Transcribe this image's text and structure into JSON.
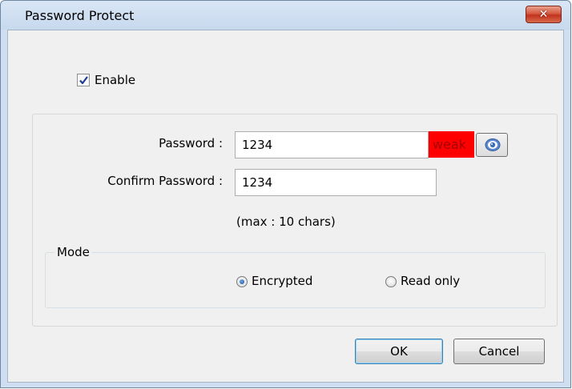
{
  "dialog": {
    "title": "Password Protect",
    "close_symbol": "✕"
  },
  "enable": {
    "label": "Enable",
    "checked": true
  },
  "password": {
    "label": "Password :",
    "value": "1234",
    "strength": "weak",
    "strength_color": "#ff0000",
    "toggle_icon": "eye-icon"
  },
  "confirm": {
    "label": "Confirm Password :",
    "value": "1234"
  },
  "hint": "(max : 10 chars)",
  "mode": {
    "legend": "Mode",
    "options": [
      {
        "label": "Encrypted",
        "checked": true
      },
      {
        "label": "Read only",
        "checked": false
      }
    ]
  },
  "buttons": {
    "ok": "OK",
    "cancel": "Cancel"
  }
}
